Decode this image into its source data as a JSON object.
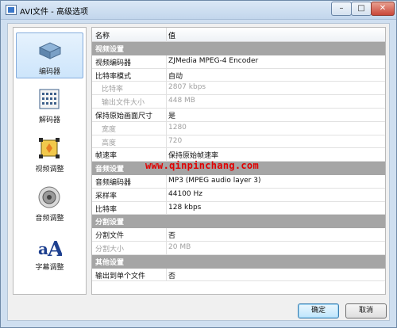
{
  "window": {
    "title": "AVI文件 - 高级选项"
  },
  "sidebar": {
    "items": [
      {
        "label": "编码器",
        "icon": "encoder-icon",
        "active": true
      },
      {
        "label": "解码器",
        "icon": "decoder-icon",
        "active": false
      },
      {
        "label": "视频调整",
        "icon": "video-adjust-icon",
        "active": false
      },
      {
        "label": "音频调整",
        "icon": "speaker-icon",
        "active": false
      },
      {
        "label": "字幕调整",
        "icon": "subtitle-icon",
        "active": false
      }
    ]
  },
  "grid": {
    "headers": {
      "name": "名称",
      "value": "值"
    },
    "rows": [
      {
        "type": "section",
        "name": "视频设置",
        "value": ""
      },
      {
        "type": "normal",
        "name": "视频编码器",
        "value": "ZJMedia MPEG-4 Encoder"
      },
      {
        "type": "normal",
        "name": "比特率模式",
        "value": "自动"
      },
      {
        "type": "sub-disabled",
        "name": "比特率",
        "value": "2807 kbps"
      },
      {
        "type": "sub-disabled",
        "name": "输出文件大小",
        "value": "448 MB"
      },
      {
        "type": "normal",
        "name": "保持原始画面尺寸",
        "value": "是"
      },
      {
        "type": "sub-disabled",
        "name": "宽度",
        "value": "1280"
      },
      {
        "type": "sub-disabled",
        "name": "高度",
        "value": "720"
      },
      {
        "type": "normal",
        "name": "帧速率",
        "value": "保持原始帧速率"
      },
      {
        "type": "section",
        "name": "音频设置",
        "value": ""
      },
      {
        "type": "normal",
        "name": "音频编码器",
        "value": "MP3 (MPEG audio layer 3)"
      },
      {
        "type": "normal",
        "name": "采样率",
        "value": "44100 Hz"
      },
      {
        "type": "normal",
        "name": "比特率",
        "value": "128 kbps"
      },
      {
        "type": "section",
        "name": "分割设置",
        "value": ""
      },
      {
        "type": "normal",
        "name": "分割文件",
        "value": "否"
      },
      {
        "type": "disabled",
        "name": "分割大小",
        "value": "20 MB"
      },
      {
        "type": "section",
        "name": "其他设置",
        "value": ""
      },
      {
        "type": "normal",
        "name": "输出到单个文件",
        "value": "否"
      }
    ]
  },
  "buttons": {
    "ok": "确定",
    "cancel": "取消"
  },
  "watermark": "www.qinpinchang.com",
  "colors": {
    "section_bg": "#a5a5a5",
    "accent": "#3c7fb1",
    "watermark": "#e00000"
  }
}
